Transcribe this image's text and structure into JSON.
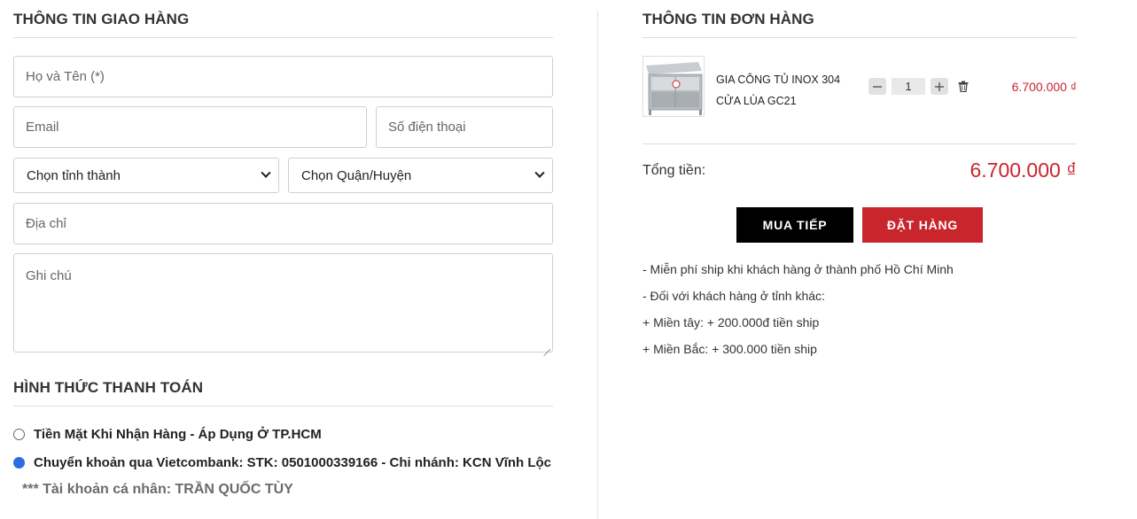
{
  "shipping": {
    "title": "THÔNG TIN GIAO HÀNG",
    "name_placeholder": "Họ và Tên (*)",
    "email_placeholder": "Email",
    "phone_placeholder": "Số điện thoại",
    "province_selected": "Chọn tỉnh thành",
    "district_selected": "Chọn Quận/Huyện",
    "address_placeholder": "Địa chỉ",
    "note_placeholder": "Ghi chú"
  },
  "payment": {
    "title": "HÌNH THỨC THANH TOÁN",
    "options": [
      {
        "label": "Tiền Mặt Khi Nhận Hàng - Áp Dụng Ở TP.HCM",
        "checked": false
      },
      {
        "label": "Chuyển khoản qua Vietcombank: STK: 0501000339166 - Chi nhánh: KCN Vĩnh Lộc",
        "checked": true
      }
    ],
    "account_note": "*** Tài khoản cá nhân: TRẦN QUỐC TÙY"
  },
  "order": {
    "title": "THÔNG TIN ĐƠN HÀNG",
    "item": {
      "name": "GIA CÔNG TỦ INOX 304 CỬA LÙA GC21",
      "quantity": "1",
      "price": "6.700.000 ₫",
      "icons": [
        "minus-icon",
        "plus-icon",
        "trash-icon"
      ]
    },
    "total_label": "Tổng tiền:",
    "total_value": "6.700.000 ₫",
    "continue_label": "MUA TIẾP",
    "order_label": "ĐẶT HÀNG",
    "shipping_notes": [
      "- Miễn phí ship khi khách hàng ở thành phố Hồ Chí Minh",
      "- Đối với khách hàng ở tỉnh khác:",
      "+ Miền tây: + 200.000đ tiền ship",
      "+ Miền Bắc: + 300.000 tiền ship"
    ]
  },
  "colors": {
    "accent_red": "#c9252c",
    "radio_blue": "#2d6ce0",
    "continue_black": "#000000"
  }
}
